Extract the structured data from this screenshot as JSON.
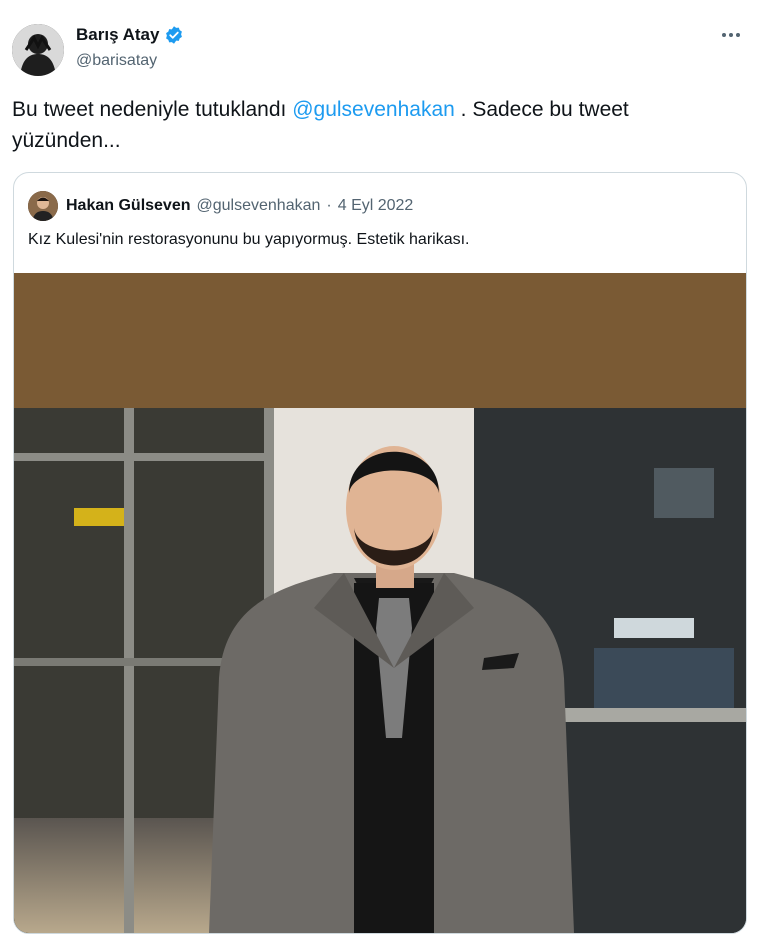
{
  "tweet": {
    "author_name": "Barış Atay",
    "author_handle": "@barisatay",
    "text_part1": "Bu tweet nedeniyle tutuklandı ",
    "mention": "@gulsevenhakan",
    "text_part2": " . Sadece bu tweet yüzünden..."
  },
  "quoted": {
    "author_name": "Hakan Gülseven",
    "author_handle": "@gulsevenhakan",
    "separator": "·",
    "date": "4 Eyl 2022",
    "text": "Kız Kulesi'nin restorasyonunu bu yapıyormuş. Estetik harikası."
  },
  "icons": {
    "verified": "verified-badge-icon",
    "more": "more-options-icon"
  },
  "colors": {
    "link": "#1d9bf0",
    "verified": "#1d9bf0",
    "secondary_text": "#536471",
    "media_band": "#7a5a34"
  }
}
